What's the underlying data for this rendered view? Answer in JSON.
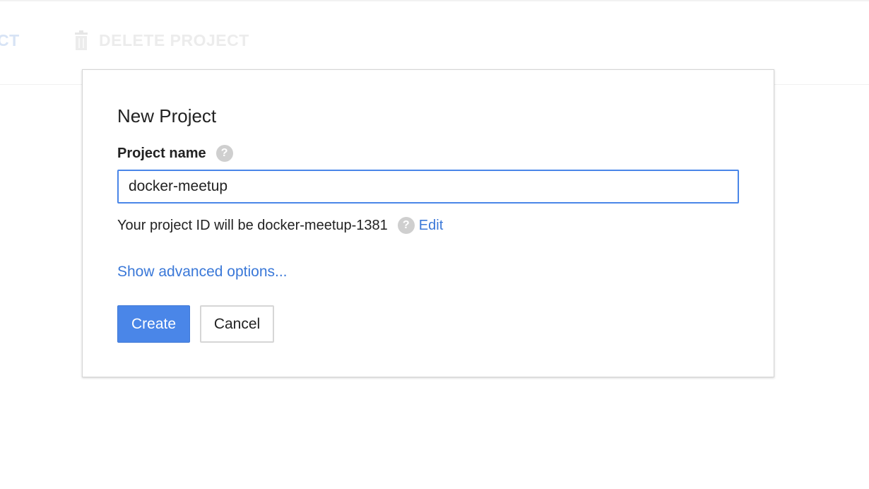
{
  "toolbar": {
    "left_action_label": "CT",
    "delete_label": "DELETE PROJECT",
    "delete_icon": "trash-icon"
  },
  "dialog": {
    "title": "New Project",
    "project_name_label": "Project name",
    "project_name_value": "docker-meetup",
    "help_icon": "help-icon",
    "project_id_text": "Your project ID will be docker-meetup-1381",
    "edit_label": "Edit",
    "advanced_options_label": "Show advanced options...",
    "create_label": "Create",
    "cancel_label": "Cancel"
  },
  "colors": {
    "accent": "#4a86e8",
    "link": "#3a78d8"
  }
}
